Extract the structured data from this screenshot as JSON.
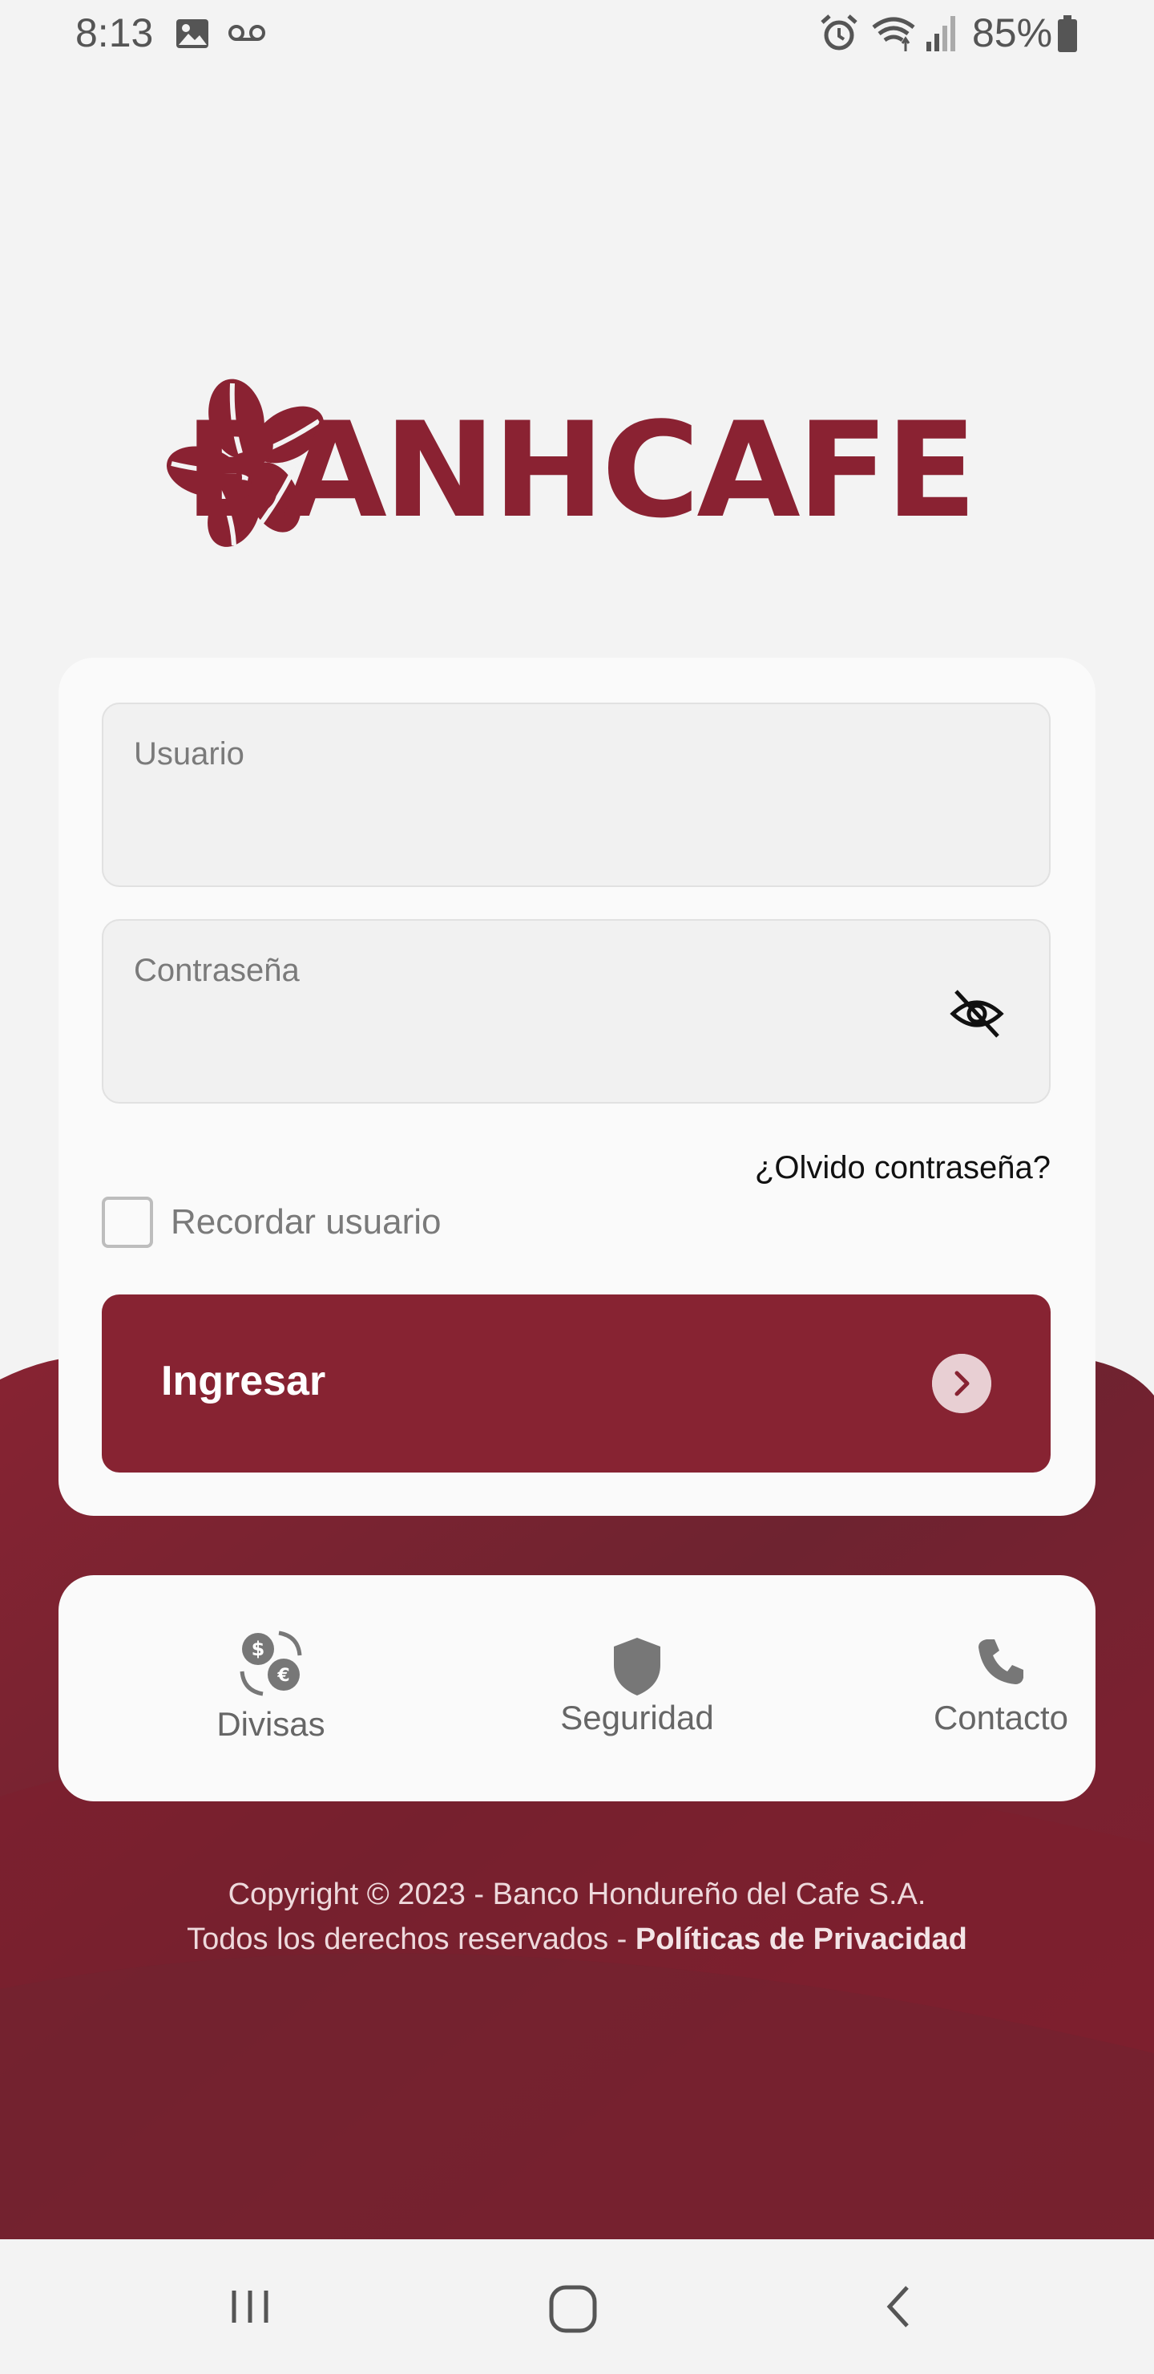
{
  "status_bar": {
    "time": "8:13",
    "battery": "85%",
    "icons": [
      "image-icon",
      "voicemail-icon",
      "alarm-icon",
      "wifi-icon",
      "signal-icon",
      "battery-icon"
    ]
  },
  "brand": {
    "name": "BANHCAFE",
    "color": "#8a2232"
  },
  "login": {
    "username_label": "Usuario",
    "password_label": "Contraseña",
    "forgot_password": "¿Olvido contraseña?",
    "remember_label": "Recordar usuario",
    "remember_checked": false,
    "submit_label": "Ingresar",
    "accent": "#872332"
  },
  "quick_links": [
    {
      "label": "Divisas",
      "icon": "currency-exchange-icon"
    },
    {
      "label": "Seguridad",
      "icon": "shield-icon"
    },
    {
      "label": "Contacto",
      "icon": "phone-icon"
    }
  ],
  "footer": {
    "copyright": "Copyright © 2023 - Banco Hondureño del Cafe S.A.",
    "rights": "Todos los derechos reservados -",
    "privacy_link": "Políticas de Privacidad"
  },
  "nav_bar": {
    "icons": [
      "recent-apps-icon",
      "home-icon",
      "back-icon"
    ]
  }
}
